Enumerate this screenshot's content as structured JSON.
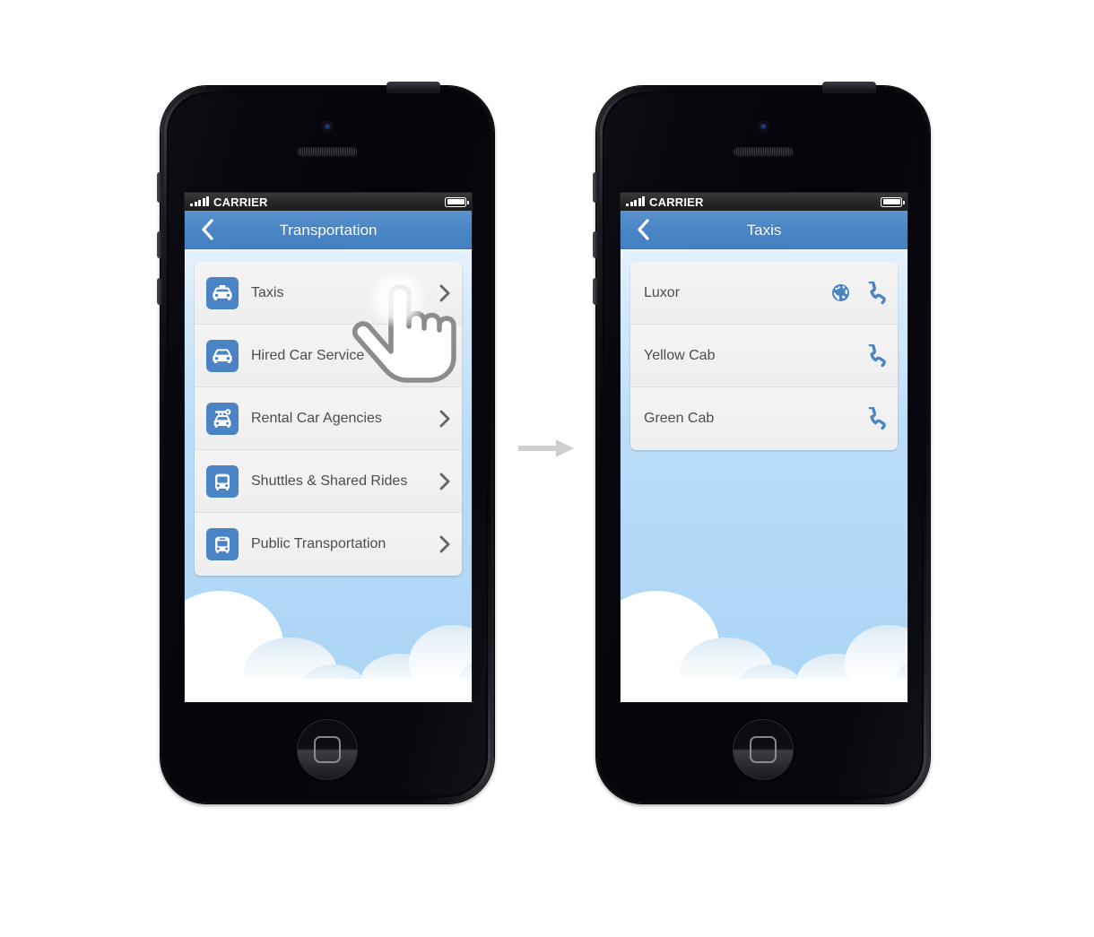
{
  "background_color": "#ffffff",
  "theme": {
    "accent_blue": "#4a84c4",
    "navbar_blue": "#4a84c4",
    "sky_top": "#e6f2fc",
    "sky_bottom": "#abd4f4",
    "card_bg": "#f0f0f0",
    "row_text": "#4d4d4d",
    "chevron_gray": "#636363",
    "statusbar_bg": "#262626",
    "arrow_gray": "#cfcfcf"
  },
  "flow": {
    "arrow_icon": "arrow-right-icon",
    "direction": "left-to-right"
  },
  "phones": [
    {
      "id": "before",
      "status_bar": {
        "signal_icon": "signal-bars-icon",
        "carrier": "CARRIER",
        "battery_icon": "battery-full-icon"
      },
      "navbar": {
        "back_icon": "chevron-left-icon",
        "title": "Transportation"
      },
      "list": [
        {
          "icon": "taxi-icon",
          "label": "Taxis",
          "accessory": "chevron-right-icon"
        },
        {
          "icon": "car-icon",
          "label": "Hired Car Service",
          "accessory": "chevron-right-icon"
        },
        {
          "icon": "rental-car-key-icon",
          "label": "Rental Car Agencies",
          "accessory": "chevron-right-icon"
        },
        {
          "icon": "shuttle-bus-icon",
          "label": "Shuttles & Shared Rides",
          "accessory": "chevron-right-icon"
        },
        {
          "icon": "public-bus-icon",
          "label": "Public Transportation",
          "accessory": "chevron-right-icon"
        }
      ],
      "cursor": {
        "icon": "pointing-hand-cursor",
        "target_label": "Taxis"
      }
    },
    {
      "id": "after",
      "status_bar": {
        "signal_icon": "signal-bars-icon",
        "carrier": "CARRIER",
        "battery_icon": "battery-full-icon"
      },
      "navbar": {
        "back_icon": "chevron-left-icon",
        "title": "Taxis"
      },
      "list": [
        {
          "label": "Luxor",
          "actions": [
            "globe-icon",
            "phone-icon"
          ]
        },
        {
          "label": "Yellow Cab",
          "actions": [
            "phone-icon"
          ]
        },
        {
          "label": "Green Cab",
          "actions": [
            "phone-icon"
          ]
        }
      ]
    }
  ]
}
